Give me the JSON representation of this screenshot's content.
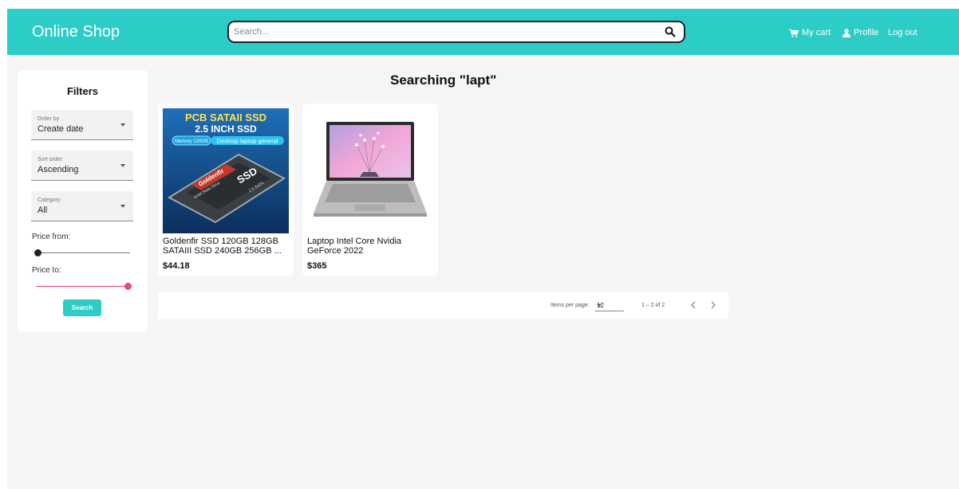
{
  "header": {
    "brand": "Online Shop",
    "search_placeholder": "Search...",
    "nav": {
      "cart": "My cart",
      "profile": "Profile",
      "logout": "Log out"
    }
  },
  "filters": {
    "title": "Filters",
    "order_by": {
      "label": "Order by",
      "value": "Create date"
    },
    "sort_order": {
      "label": "Sort order",
      "value": "Ascending"
    },
    "category": {
      "label": "Category",
      "value": "All"
    },
    "price_from_label": "Price from:",
    "price_to_label": "Price to:",
    "price_from_fraction": 0.0,
    "price_to_fraction": 1.0,
    "search_button": "Search"
  },
  "results": {
    "heading": "Searching \"lapt\"",
    "products": [
      {
        "name": "Goldenfir SSD 120GB 128GB SATAIII SSD 240GB 256GB ...",
        "price": "$44.18",
        "image_text_1": "PCB SATAII SSD",
        "image_text_2": "2.5 INCH SSD",
        "image_badge": "Memory 120GB",
        "image_caption": "Desktop laptop general",
        "image_brand": "Goldenfir",
        "image_model": "SSD",
        "image_sub": "Solid State Drive",
        "image_sata": "2.5 SATA"
      },
      {
        "name": "Laptop Intel Core Nvidia GeForce 2022",
        "price": "$365"
      }
    ]
  },
  "paginator": {
    "items_per_page_label": "Items per page:",
    "items_per_page": "12",
    "range": "1 – 2 of 2"
  },
  "colors": {
    "accent": "#2ccdc6",
    "slider_active": "#e8467c",
    "background": "#f5f5f5"
  }
}
